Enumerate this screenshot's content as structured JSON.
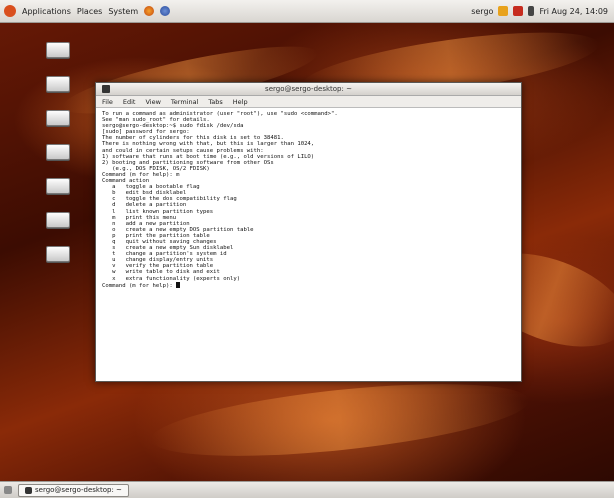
{
  "top_panel": {
    "menus": [
      "Applications",
      "Places",
      "System"
    ],
    "user": "sergo",
    "clock": "Fri Aug 24, 14:09"
  },
  "desktop": {
    "icons": [
      "",
      "",
      "",
      "",
      "",
      "",
      "",
      ""
    ]
  },
  "terminal": {
    "title": "sergo@sergo-desktop: ~",
    "menu": [
      "File",
      "Edit",
      "View",
      "Terminal",
      "Tabs",
      "Help"
    ],
    "lines": [
      "To run a command as administrator (user \"root\"), use \"sudo <command>\".",
      "See \"man sudo_root\" for details.",
      "",
      "sergo@sergo-desktop:~$ sudo fdisk /dev/sda",
      "[sudo] password for sergo:",
      "",
      "The number of cylinders for this disk is set to 38481.",
      "There is nothing wrong with that, but this is larger than 1024,",
      "and could in certain setups cause problems with:",
      "1) software that runs at boot time (e.g., old versions of LILO)",
      "2) booting and partitioning software from other OSs",
      "   (e.g., DOS FDISK, OS/2 FDISK)",
      "",
      "Command (m for help): m",
      "Command action",
      "   a   toggle a bootable flag",
      "   b   edit bsd disklabel",
      "   c   toggle the dos compatibility flag",
      "   d   delete a partition",
      "   l   list known partition types",
      "   m   print this menu",
      "   n   add a new partition",
      "   o   create a new empty DOS partition table",
      "   p   print the partition table",
      "   q   quit without saving changes",
      "   s   create a new empty Sun disklabel",
      "   t   change a partition's system id",
      "   u   change display/entry units",
      "   v   verify the partition table",
      "   w   write table to disk and exit",
      "   x   extra functionality (experts only)",
      "",
      "Command (m for help): "
    ]
  },
  "bottom_panel": {
    "task": "sergo@sergo-desktop: ~"
  },
  "colors": {
    "wallpaper_dark": "#3c0c02",
    "wallpaper_glow": "#e06a28",
    "panel": "#e3e0dc"
  }
}
